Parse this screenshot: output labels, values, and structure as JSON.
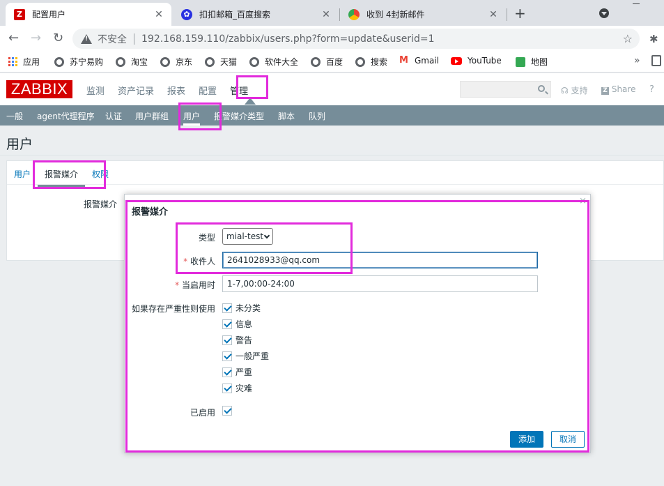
{
  "browser": {
    "tabs": [
      {
        "title": "配置用户",
        "icon": "zabbix-icon"
      },
      {
        "title": "扣扣邮箱_百度搜索",
        "icon": "baidu-icon"
      },
      {
        "title": "收到 4封新邮件",
        "icon": "mail-icon"
      }
    ],
    "address": {
      "security": "不安全",
      "url": "192.168.159.110/zabbix/users.php?form=update&userid=1"
    },
    "bookmarks": [
      {
        "label": "应用",
        "icon": "apps-icon"
      },
      {
        "label": "苏宁易购",
        "icon": "globe-icon"
      },
      {
        "label": "淘宝",
        "icon": "globe-icon"
      },
      {
        "label": "京东",
        "icon": "globe-icon"
      },
      {
        "label": "天猫",
        "icon": "globe-icon"
      },
      {
        "label": "软件大全",
        "icon": "globe-icon"
      },
      {
        "label": "百度",
        "icon": "globe-icon"
      },
      {
        "label": "搜索",
        "icon": "globe-icon"
      },
      {
        "label": "Gmail",
        "icon": "gmail-icon"
      },
      {
        "label": "YouTube",
        "icon": "youtube-icon"
      },
      {
        "label": "地图",
        "icon": "maps-icon"
      }
    ]
  },
  "zabbix": {
    "logo": "ZABBIX",
    "menu": [
      "监测",
      "资产记录",
      "报表",
      "配置",
      "管理"
    ],
    "support": "支持",
    "share": "Share",
    "help": "?",
    "submenu": [
      "一般",
      "agent代理程序",
      "认证",
      "用户群组",
      "用户",
      "报警媒介类型",
      "脚本",
      "队列"
    ],
    "page_title": "用户",
    "form_tabs": [
      "用户",
      "报警媒介",
      "权限"
    ],
    "media_label": "报警媒介"
  },
  "dialog": {
    "title": "报警媒介",
    "close": "×",
    "type_label": "类型",
    "type_value": "mial-test",
    "send_to_label": "收件人",
    "send_to_value": "2641028933@qq.com",
    "when_active_label": "当启用时",
    "when_active_value": "1-7,00:00-24:00",
    "severity_label": "如果存在严重性则使用",
    "severities": [
      "未分类",
      "信息",
      "警告",
      "一般严重",
      "严重",
      "灾难"
    ],
    "enabled_label": "已启用",
    "add_button": "添加",
    "cancel_button": "取消"
  },
  "colors": {
    "zabbix_red": "#d40000",
    "submenu_bg": "#768d99",
    "link_blue": "#0275b8",
    "highlight": "#e22bdc"
  }
}
